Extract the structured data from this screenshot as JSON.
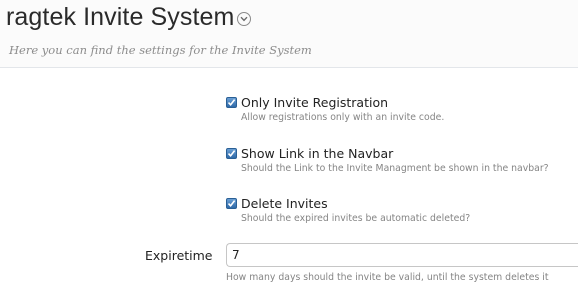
{
  "header": {
    "title": "ragtek Invite System",
    "subtitle": "Here you can find the settings for the Invite System",
    "menu_icon": "chevron-down-icon"
  },
  "options": [
    {
      "label": "Only Invite Registration",
      "description": "Allow registrations only with an invite code.",
      "checked": true
    },
    {
      "label": "Show Link in the Navbar",
      "description": "Should the Link to the Invite Managment be shown in the navbar?",
      "checked": true
    },
    {
      "label": "Delete Invites",
      "description": "Should the expired invites be automatic deleted?",
      "checked": true
    }
  ],
  "expiretime": {
    "label": "Expiretime",
    "value": "7",
    "hint": "How many days should the invite be valid, until the system deletes it"
  },
  "colors": {
    "checkbox": "#2f6aa9",
    "header_bg": "#fbfbfb"
  }
}
